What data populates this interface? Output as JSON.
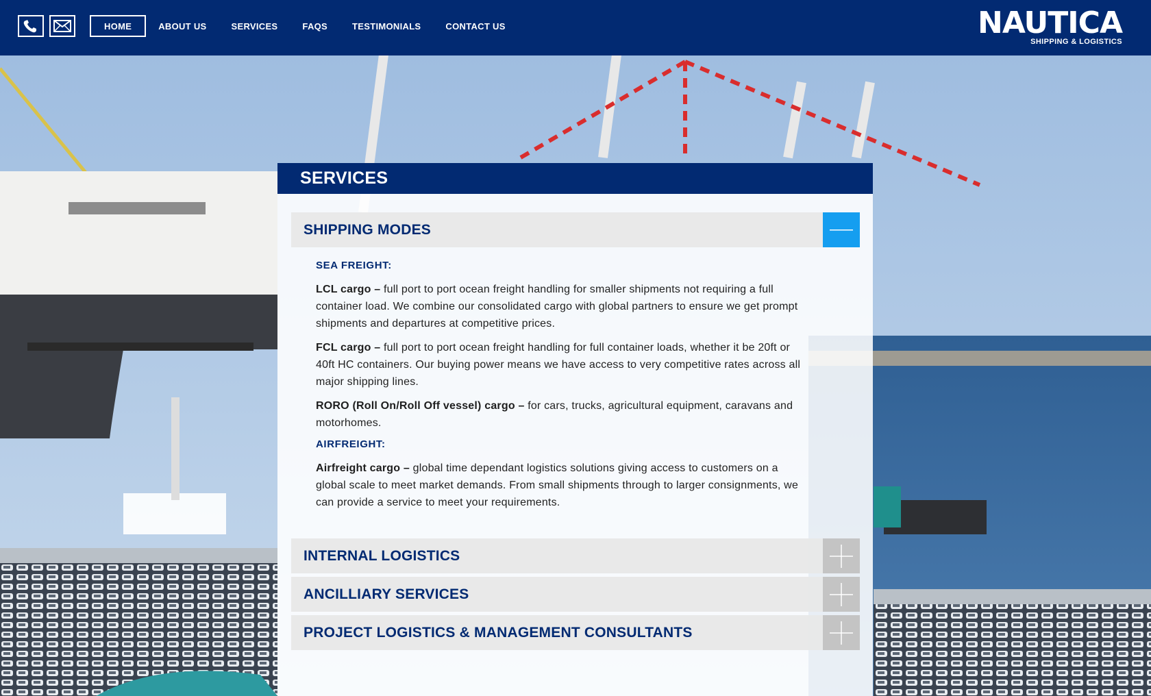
{
  "header": {
    "phone_icon": "phone-icon",
    "mail_icon": "envelope-icon",
    "nav": [
      {
        "label": "HOME",
        "active": true
      },
      {
        "label": "ABOUT US"
      },
      {
        "label": "SERVICES"
      },
      {
        "label": "FAQS"
      },
      {
        "label": "TESTIMONIALS"
      },
      {
        "label": "CONTACT US"
      }
    ],
    "logo_word": "NAUTICA",
    "logo_tagline": "SHIPPING & LOGISTICS"
  },
  "panel": {
    "title": "SERVICES",
    "sections": [
      {
        "title": "SHIPPING MODES",
        "expanded": true,
        "toggle_icon": "minus-icon",
        "subsections": [
          {
            "heading": "SEA FREIGHT:",
            "items": [
              {
                "term": "LCL cargo –",
                "text": " full port to port ocean freight handling for smaller shipments not requiring a full container load. We combine our consolidated cargo with global partners to ensure we get prompt shipments and departures at competitive prices."
              },
              {
                "term": "FCL cargo –",
                "text": " full port to port ocean freight handling for full container loads, whether it be 20ft or 40ft HC containers. Our buying power means we have access to very competitive rates across all major shipping lines."
              },
              {
                "term": "RORO (Roll On/Roll Off vessel) cargo –",
                "text": " for cars, trucks, agricultural equipment, caravans and motorhomes."
              }
            ]
          },
          {
            "heading": "AIRFREIGHT:",
            "items": [
              {
                "term": "Airfreight cargo –",
                "text": " global time dependant logistics solutions giving access to customers on a global scale to meet market demands. From small shipments through to larger consignments, we can provide a service to meet your requirements."
              }
            ]
          }
        ]
      },
      {
        "title": "INTERNAL LOGISTICS",
        "expanded": false,
        "toggle_icon": "plus-icon"
      },
      {
        "title": "ANCILLIARY SERVICES",
        "expanded": false,
        "toggle_icon": "plus-icon"
      },
      {
        "title": "PROJECT LOGISTICS & MANAGEMENT CONSULTANTS",
        "expanded": false,
        "toggle_icon": "plus-icon"
      }
    ]
  },
  "colors": {
    "brand_navy": "#022a72",
    "toggle_active": "#159ef0",
    "toggle_inactive": "#c4c4c4"
  }
}
